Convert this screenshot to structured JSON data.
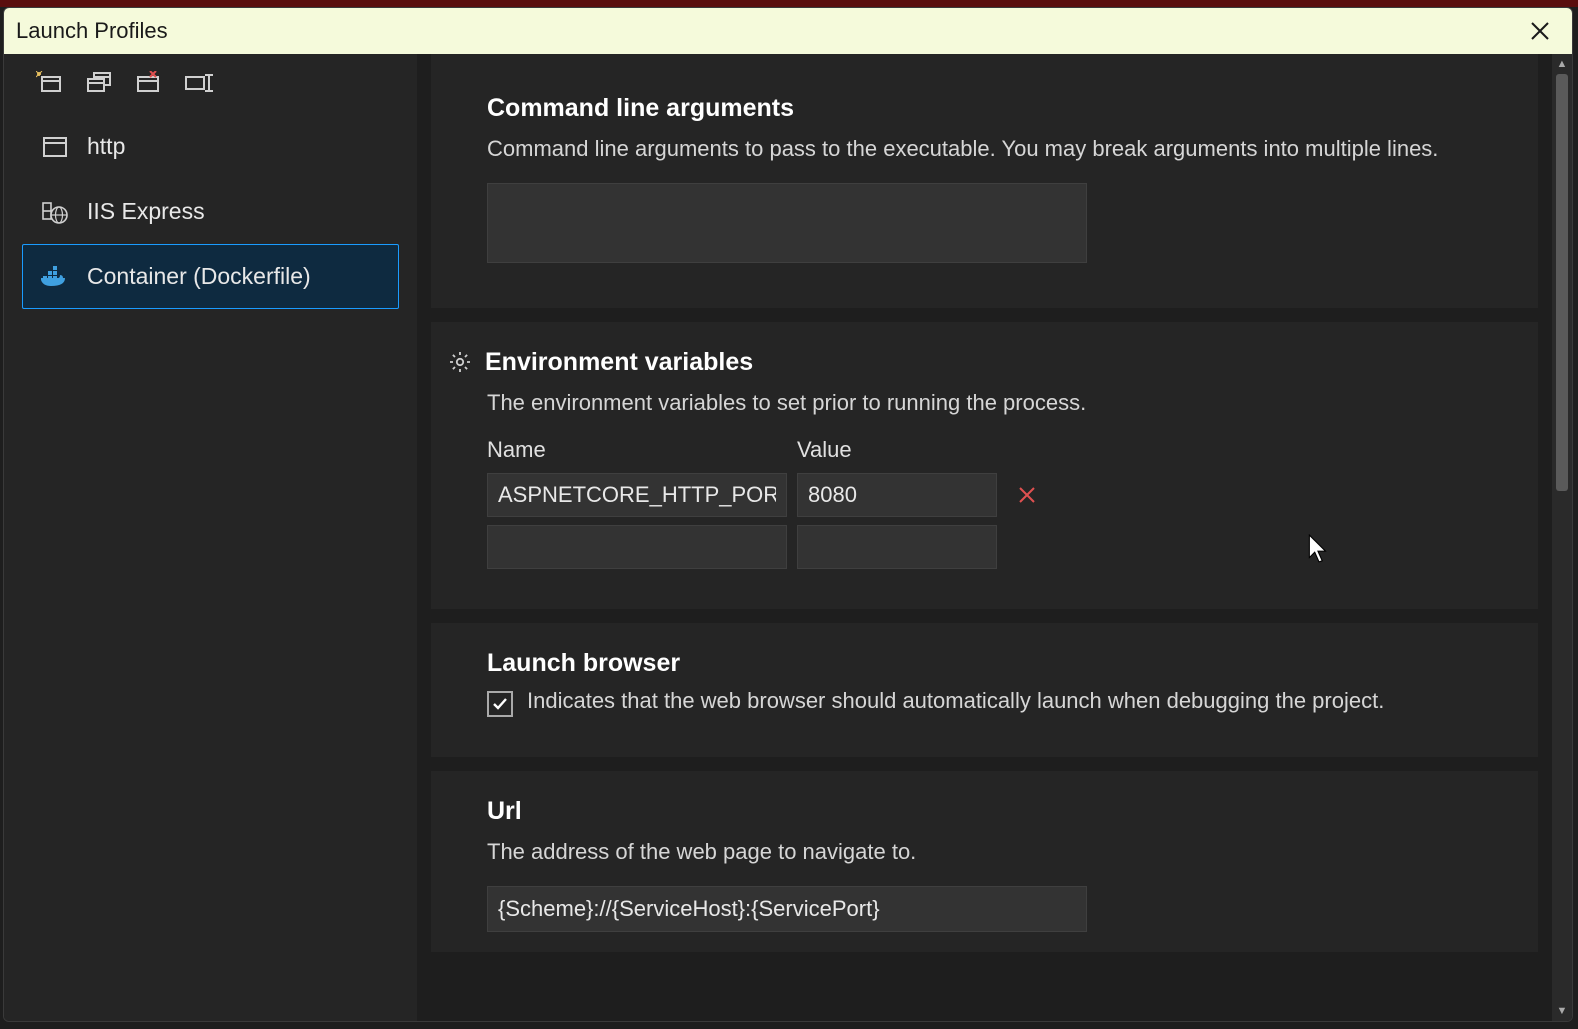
{
  "dialog": {
    "title": "Launch Profiles"
  },
  "sidebar": {
    "tools": {
      "new": "new-profile-icon",
      "duplicate": "duplicate-profile-icon",
      "delete": "delete-profile-icon",
      "rename": "rename-profile-icon"
    },
    "profiles": [
      {
        "label": "http",
        "icon": "window"
      },
      {
        "label": "IIS Express",
        "icon": "globe"
      },
      {
        "label": "Container (Dockerfile)",
        "icon": "docker",
        "selected": true
      }
    ]
  },
  "sections": {
    "cmdline": {
      "title": "Command line arguments",
      "desc": "Command line arguments to pass to the executable. You may break arguments into multiple lines.",
      "value": ""
    },
    "env": {
      "title": "Environment variables",
      "desc": "The environment variables to set prior to running the process.",
      "columns": {
        "name": "Name",
        "value": "Value"
      },
      "rows": [
        {
          "name": "ASPNETCORE_HTTP_PORTS",
          "value": "8080"
        },
        {
          "name": "",
          "value": ""
        }
      ]
    },
    "launchBrowser": {
      "title": "Launch browser",
      "checked": true,
      "desc": "Indicates that the web browser should automatically launch when debugging the project."
    },
    "url": {
      "title": "Url",
      "desc": "The address of the web page to navigate to.",
      "value": "{Scheme}://{ServiceHost}:{ServicePort}"
    }
  }
}
